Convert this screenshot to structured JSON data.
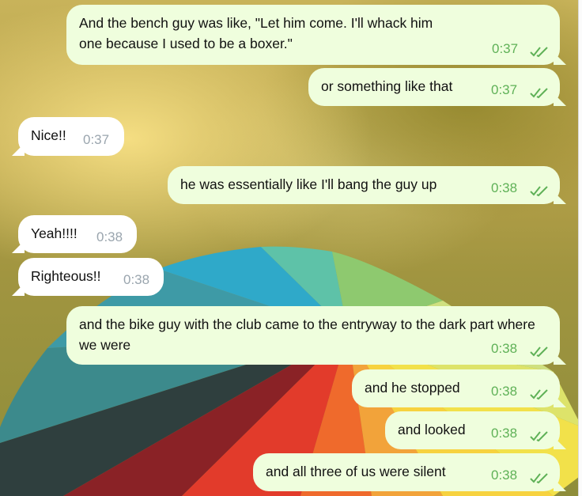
{
  "messages": [
    {
      "dir": "out",
      "text": "And the bench guy was like, \"Let him come. I'll whack him one because I used to be a boxer.\"",
      "time": "0:37",
      "read": true
    },
    {
      "dir": "out",
      "text": "or something like that",
      "time": "0:37",
      "read": true
    },
    {
      "dir": "in",
      "text": "Nice!!",
      "time": "0:37"
    },
    {
      "dir": "out",
      "text": "he was essentially like I'll bang the guy up",
      "time": "0:38",
      "read": true
    },
    {
      "dir": "in",
      "text": "Yeah!!!!",
      "time": "0:38"
    },
    {
      "dir": "in",
      "text": "Righteous!!",
      "time": "0:38"
    },
    {
      "dir": "out",
      "text": "and the bike guy with the club came to the entryway to the dark part where we were",
      "time": "0:38",
      "read": true
    },
    {
      "dir": "out",
      "text": "and he stopped",
      "time": "0:38",
      "read": true
    },
    {
      "dir": "out",
      "text": "and looked",
      "time": "0:38",
      "read": true
    },
    {
      "dir": "out",
      "text": "and all three of us were silent",
      "time": "0:38",
      "read": true
    }
  ],
  "colors": {
    "outgoing_bubble": "#effedd",
    "incoming_bubble": "#ffffff",
    "time_outgoing": "#5fb157",
    "time_incoming": "#9aa5ae"
  },
  "icons": {
    "read_receipt": "double-check-icon"
  }
}
